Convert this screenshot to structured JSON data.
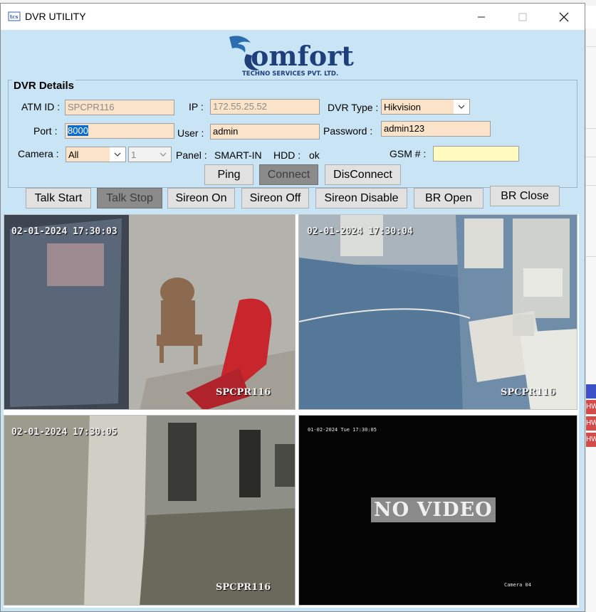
{
  "window": {
    "title": "DVR UTILITY"
  },
  "logo": {
    "main": "Comfort",
    "sub": "TECHNO SERVICES PVT. LTD."
  },
  "details": {
    "legend": "DVR Details",
    "atm_id_label": "ATM ID :",
    "atm_id_value": "SPCPR116",
    "ip_label": "IP :",
    "ip_value": "172.55.25.52",
    "dvr_type_label": "DVR Type :",
    "dvr_type_value": "Hikvision",
    "port_label": "Port :",
    "port_value": "8000",
    "user_label": "User :",
    "user_value": "admin",
    "password_label": "Password :",
    "password_value": "admin123",
    "camera_label": "Camera :",
    "camera_value": "All",
    "camera_num_value": "1",
    "panel_label": "Panel :",
    "panel_value": "SMART-IN",
    "hdd_label": "HDD :",
    "hdd_value": "ok",
    "gsm_label": "GSM # :",
    "gsm_value": ""
  },
  "buttons": {
    "ping": "Ping",
    "connect": "Connect",
    "disconnect": "DisConnect",
    "talk_start": "Talk Start",
    "talk_stop": "Talk Stop",
    "sireon_on": "Sireon On",
    "sireon_off": "Sireon Off",
    "sireon_disable": "Sireon Disable",
    "br_open": "BR Open",
    "br_close": "BR Close"
  },
  "cameras": [
    {
      "timestamp": "02-01-2024 17:30:03",
      "name": "SPCPR116"
    },
    {
      "timestamp": "02-01-2024 17:30:04",
      "name": "SPCPR116"
    },
    {
      "timestamp": "02-01-2024 17:30:05",
      "name": "SPCPR116"
    },
    {
      "timestamp": "01-02-2024 Tue 17:30:05",
      "status": "NO VIDEO",
      "name": "Camera 04"
    }
  ],
  "background": {
    "url_fragment": "https://...",
    "badge": "HW"
  }
}
